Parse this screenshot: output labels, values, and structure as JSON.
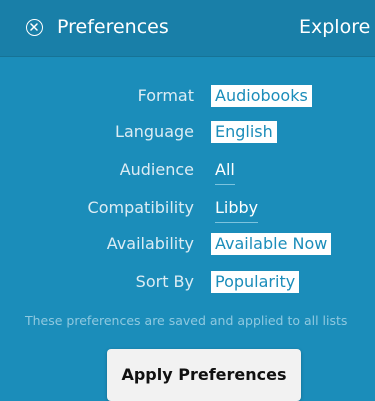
{
  "header": {
    "title": "Preferences",
    "explore_label": "Explore"
  },
  "preferences": {
    "format": {
      "label": "Format",
      "value": "Audiobooks"
    },
    "language": {
      "label": "Language",
      "value": "English"
    },
    "audience": {
      "label": "Audience",
      "value": "All"
    },
    "compatibility": {
      "label": "Compatibility",
      "value": "Libby"
    },
    "availability": {
      "label": "Availability",
      "value": "Available Now"
    },
    "sort_by": {
      "label": "Sort By",
      "value": "Popularity"
    }
  },
  "note": "These preferences are saved and applied to all lists",
  "apply_button": "Apply Preferences",
  "colors": {
    "background": "#1b8dba",
    "header": "#197fa8",
    "pill_background": "#ffffff",
    "button_background": "#f2f2f2"
  },
  "icons": {
    "close": "close-circle-icon"
  }
}
